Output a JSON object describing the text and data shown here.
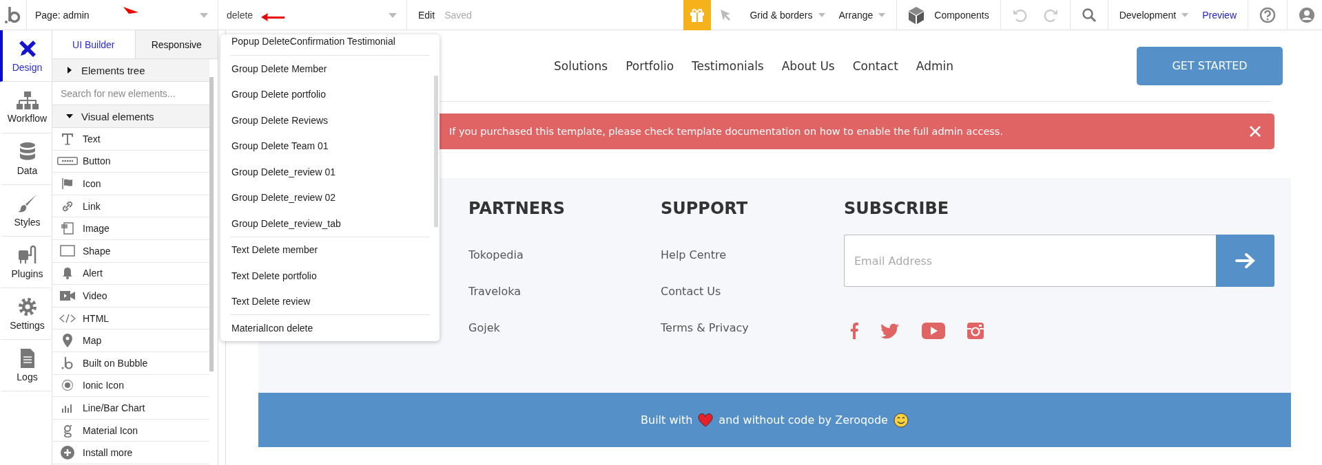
{
  "toolbar": {
    "page_selector": "Page: admin",
    "element_search": "delete",
    "edit": "Edit",
    "status": "Saved",
    "grid": "Grid & borders",
    "arrange": "Arrange",
    "components": "Components",
    "mode": "Development",
    "preview": "Preview"
  },
  "sidebar": {
    "items": [
      {
        "kind": "design",
        "label": "Design",
        "selected": true
      },
      {
        "kind": "workflow",
        "label": "Workflow",
        "selected": false
      },
      {
        "kind": "data",
        "label": "Data",
        "selected": false
      },
      {
        "kind": "styles",
        "label": "Styles",
        "selected": false
      },
      {
        "kind": "plugins",
        "label": "Plugins",
        "selected": false
      },
      {
        "kind": "settings",
        "label": "Settings",
        "selected": false
      },
      {
        "kind": "logs",
        "label": "Logs",
        "selected": false
      }
    ]
  },
  "panel": {
    "tabs": [
      {
        "label": "UI Builder",
        "selected": true
      },
      {
        "label": "Responsive",
        "selected": false
      }
    ],
    "elements_tree": {
      "label": "Elements tree",
      "expanded": false
    },
    "search": {
      "placeholder": "Search for new elements..."
    },
    "visual_elements": {
      "label": "Visual elements",
      "expanded": true
    },
    "items": [
      {
        "kind": "text",
        "label": "Text"
      },
      {
        "kind": "button",
        "label": "Button"
      },
      {
        "kind": "icon",
        "label": "Icon"
      },
      {
        "kind": "link",
        "label": "Link"
      },
      {
        "kind": "image",
        "label": "Image"
      },
      {
        "kind": "shape",
        "label": "Shape"
      },
      {
        "kind": "alert",
        "label": "Alert"
      },
      {
        "kind": "video",
        "label": "Video"
      },
      {
        "kind": "html",
        "label": "HTML"
      },
      {
        "kind": "map",
        "label": "Map"
      },
      {
        "kind": "bubble",
        "label": "Built on Bubble"
      },
      {
        "kind": "ionic",
        "label": "Ionic Icon"
      },
      {
        "kind": "chart",
        "label": "Line/Bar Chart"
      },
      {
        "kind": "material",
        "label": "Material Icon"
      },
      {
        "kind": "install",
        "label": "Install more"
      }
    ]
  },
  "dropdown": {
    "groups": [
      [
        "Popup DeleteConfirmation Testimonial"
      ],
      [
        "Group Delete Member",
        "Group Delete portfolio",
        "Group Delete Reviews",
        "Group Delete Team 01",
        "Group Delete_review 01",
        "Group Delete_review 02",
        "Group Delete_review_tab"
      ],
      [
        "Text Delete member",
        "Text Delete portfolio",
        "Text Delete review"
      ],
      [
        "MaterialIcon delete"
      ]
    ]
  },
  "page": {
    "nav": [
      "Solutions",
      "Portfolio",
      "Testimonials",
      "About Us",
      "Contact",
      "Admin"
    ],
    "cta": "GET STARTED",
    "alert": "If you purchased this template, please check template documentation on how to enable the full admin access.",
    "footer": {
      "columns": [
        {
          "title": "PARTNERS",
          "links": [
            "Tokopedia",
            "Traveloka",
            "Gojek"
          ]
        },
        {
          "title": "SUPPORT",
          "links": [
            "Help Centre",
            "Contact Us",
            "Terms & Privacy"
          ]
        }
      ],
      "subscribe": {
        "title": "SUBSCRIBE",
        "placeholder": "Email Address"
      },
      "social": [
        {
          "kind": "facebook"
        },
        {
          "kind": "twitter"
        },
        {
          "kind": "youtube"
        },
        {
          "kind": "instagram"
        }
      ]
    },
    "credits": {
      "before": "Built with",
      "after": "and without code by Zeroqode"
    }
  }
}
